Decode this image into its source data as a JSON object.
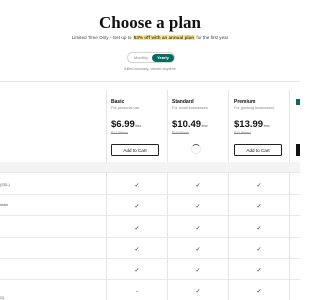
{
  "header": {
    "title": "Choose a plan",
    "subtitle_before": "Limited Time Only - Get up to",
    "subtitle_highlight": "53% off with an annual plan",
    "subtitle_after": "for the first year"
  },
  "billing_toggle": {
    "options": [
      "Monthly",
      "Yearly"
    ],
    "selected": "Yearly",
    "note": "Billed annually, cancel anytime"
  },
  "plans": [
    {
      "name": "Basic",
      "description": "For personal use",
      "price": "$6.99",
      "period": "/mo",
      "original_price": "$14.99/mo",
      "button": "Add to Cart",
      "button_state": "ready"
    },
    {
      "name": "Standard",
      "description": "For small businesses",
      "price": "$10.49",
      "period": "/mo",
      "original_price": "$19.99/mo",
      "button": "",
      "button_state": "loading"
    },
    {
      "name": "Premium",
      "description": "For growing businesses",
      "price": "$13.99",
      "period": "/mo",
      "original_price": "$24.99/mo",
      "button": "Add to Cart",
      "button_state": "ready"
    }
  ],
  "partial_plan": {
    "name": "E"
  },
  "features": [
    {
      "label": "",
      "marks": [
        "",
        "",
        ""
      ]
    },
    {
      "label": "(SSL)",
      "marks": [
        "✓",
        "✓",
        "✓"
      ]
    },
    {
      "label": "main",
      "marks": [
        "✓",
        "✓",
        "✓"
      ]
    },
    {
      "label": "",
      "marks": [
        "✓",
        "✓",
        "✓"
      ]
    },
    {
      "label": "",
      "marks": [
        "✓",
        "✓",
        "✓"
      ]
    },
    {
      "label": "",
      "marks": [
        "✓",
        "✓",
        "✓"
      ]
    },
    {
      "label": "",
      "marks": [
        "-",
        "✓",
        "✓"
      ]
    },
    {
      "label": "O)",
      "marks": [
        "✓",
        "✓",
        "✓"
      ]
    }
  ],
  "colors": {
    "accent": "#0b6b61",
    "highlight": "#fde68a",
    "band": "#f4f4f4"
  }
}
